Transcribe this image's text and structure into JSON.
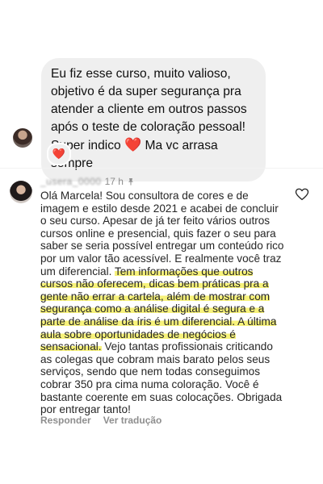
{
  "message": {
    "text_lines": [
      "Eu fiz esse curso, muito valioso,",
      "objetivo é da super segurança pra",
      "atender a cliente em outros passos",
      "após o teste de coloração pessoal!"
    ],
    "last_line_before_heart": "Super indico",
    "heart_emoji": "❤️",
    "last_line_after_heart": "Ma vc arrasa sempre",
    "reaction": "❤️"
  },
  "comment": {
    "username": "_usera_0000",
    "time": "17 h",
    "segments": [
      {
        "text": "Olá Marcela! Sou consultora de cores e de imagem e estilo desde 2021 e acabei de concluir o seu curso. Apesar de já ter feito vários outros cursos online e presencial, quis fazer o seu para saber se seria possível entregar um conteúdo rico por um valor tão acessível. E realmente você traz um diferencial. ",
        "highlight": false
      },
      {
        "text": "Tem informações que outros cursos não oferecem, dicas bem práticas pra a gente não errar a cartela, além de mostrar com segurança como a análise digital é segura e a parte de análise da íris é um diferencial. A última aula sobre oportunidades de negócios é sensacional.",
        "highlight": true
      },
      {
        "text": " Vejo tantas profissionais criticando as colegas que cobram mais barato pelos seus serviços, sendo que nem todas conseguimos cobrar 350 pra cima numa coloração. Você é bastante coerente em suas colocações. Obrigada por entregar tanto!",
        "highlight": false
      }
    ],
    "reply_label": "Responder",
    "translate_label": "Ver tradução"
  },
  "colors": {
    "bubble_bg": "#efefef",
    "highlight": "#f7f27a",
    "heart": "#e0162b",
    "meta_text": "#8e8e8e"
  }
}
